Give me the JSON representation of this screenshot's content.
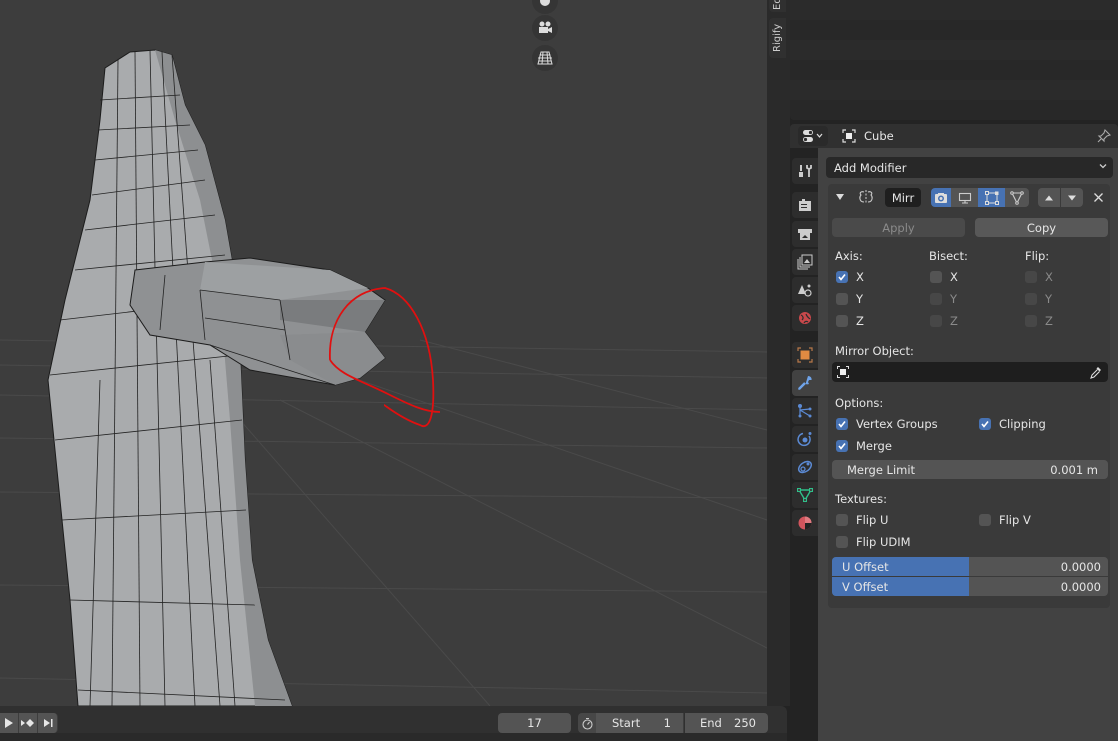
{
  "viewport": {
    "nav_buttons": [
      {
        "name": "move-view",
        "icon": "hand-icon"
      },
      {
        "name": "camera-view",
        "icon": "camera-icon"
      },
      {
        "name": "ortho-toggle",
        "icon": "grid-icon"
      }
    ]
  },
  "side_tabs": [
    "Ed",
    "Rigify"
  ],
  "properties": {
    "header": {
      "editor_type_icon": "properties-editor-icon",
      "object_name": "Cube",
      "pin_icon": "pin-icon"
    },
    "tabs": [
      {
        "name": "tool",
        "icon": "tool-icon",
        "color": "#cccccc"
      },
      {
        "name": "render",
        "icon": "render-icon",
        "color": "#cccccc"
      },
      {
        "name": "output",
        "icon": "output-icon",
        "color": "#cccccc"
      },
      {
        "name": "view-layer",
        "icon": "view-layer-icon",
        "color": "#cccccc"
      },
      {
        "name": "scene",
        "icon": "scene-icon",
        "color": "#cccccc"
      },
      {
        "name": "world",
        "icon": "world-icon",
        "color": "#c9484b"
      },
      {
        "name": "object",
        "icon": "object-icon",
        "color": "#e08a42"
      },
      {
        "name": "modifiers",
        "icon": "wrench-icon",
        "color": "#6fa3e8",
        "active": true
      },
      {
        "name": "particles",
        "icon": "particles-icon",
        "color": "#5b8ad4"
      },
      {
        "name": "physics",
        "icon": "physics-icon",
        "color": "#5b8ad4"
      },
      {
        "name": "constraints",
        "icon": "constraints-icon",
        "color": "#5b8ad4"
      },
      {
        "name": "data",
        "icon": "mesh-data-icon",
        "color": "#2fc08a"
      },
      {
        "name": "material",
        "icon": "material-icon",
        "color": "#d1555d"
      }
    ],
    "add_modifier_label": "Add Modifier",
    "modifier": {
      "name": "Mirr",
      "type_icon": "mirror-modifier-icon",
      "toggles": [
        {
          "name": "edit-mode",
          "icon": "edit-mode-icon",
          "on": true
        },
        {
          "name": "viewport",
          "icon": "monitor-icon",
          "on": false
        },
        {
          "name": "on-cage",
          "icon": "cage-icon",
          "on": true
        },
        {
          "name": "mesh",
          "icon": "vertex-triangle-icon",
          "on": false
        }
      ],
      "apply_label": "Apply",
      "copy_label": "Copy",
      "axis_label": "Axis:",
      "bisect_label": "Bisect:",
      "flip_label": "Flip:",
      "axis": [
        {
          "label": "X",
          "checked": true
        },
        {
          "label": "Y",
          "checked": false
        },
        {
          "label": "Z",
          "checked": false
        }
      ],
      "bisect": [
        {
          "label": "X",
          "checked": false
        },
        {
          "label": "Y",
          "checked": false
        },
        {
          "label": "Z",
          "checked": false
        }
      ],
      "flip": [
        {
          "label": "X",
          "checked": false
        },
        {
          "label": "Y",
          "checked": false
        },
        {
          "label": "Z",
          "checked": false
        }
      ],
      "mirror_object_label": "Mirror Object:",
      "mirror_object_value": "",
      "options_label": "Options:",
      "vertex_groups_label": "Vertex Groups",
      "vertex_groups_checked": true,
      "clipping_label": "Clipping",
      "clipping_checked": true,
      "merge_label": "Merge",
      "merge_checked": true,
      "merge_limit_label": "Merge Limit",
      "merge_limit_value": "0.001 m",
      "textures_label": "Textures:",
      "flip_u_label": "Flip U",
      "flip_v_label": "Flip V",
      "flip_udim_label": "Flip UDIM",
      "u_offset_label": "U Offset",
      "u_offset_value": "0.0000",
      "v_offset_label": "V Offset",
      "v_offset_value": "0.0000"
    }
  },
  "timeline": {
    "current_frame": "17",
    "start_label": "Start",
    "start_value": "1",
    "end_label": "End",
    "end_value": "250"
  },
  "colors": {
    "accent": "#4772b3",
    "annotation": "#e01010"
  }
}
